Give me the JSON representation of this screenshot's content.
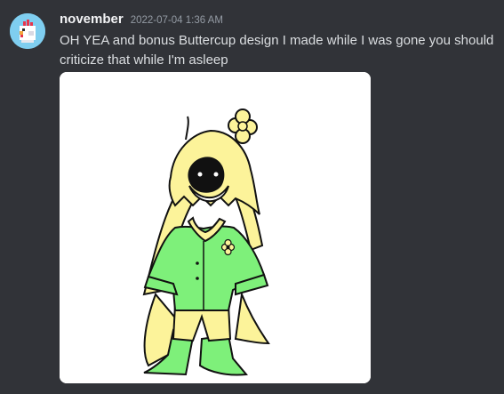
{
  "message": {
    "author": "november",
    "timestamp": "2022-07-04 1:36 AM",
    "text": "OH YEA and bonus Buttercup design I made while I was gone you should criticize that while I'm asleep",
    "avatar_icon": "chicken-avatar-icon",
    "attachment_subject": "buttercup-drawing"
  },
  "colors": {
    "background": "#313338",
    "username": "#f2f3f5",
    "timestamp": "#949ba4",
    "text": "#dbdee1",
    "hair": "#fcf39a",
    "outfit": "#7ef07a",
    "avatar_bg": "#7fcef0"
  }
}
